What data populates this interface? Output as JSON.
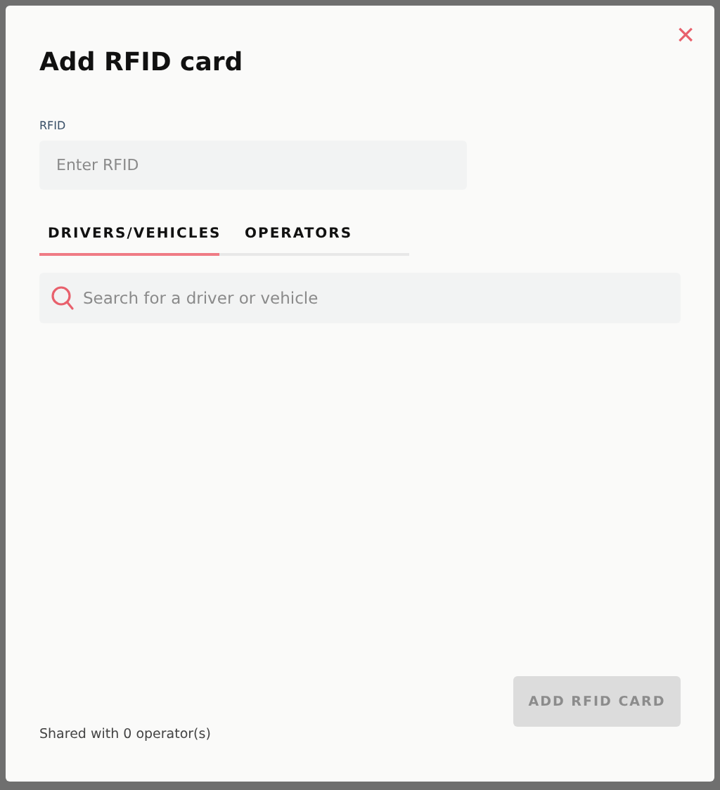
{
  "dialog": {
    "title": "Add RFID card",
    "close": "×"
  },
  "rfid": {
    "label": "RFID",
    "placeholder": "Enter RFID"
  },
  "tabs": [
    {
      "label": "DRIVERS/VEHICLES",
      "selected": true
    },
    {
      "label": "OPERATORS",
      "selected": false
    }
  ],
  "search": {
    "placeholder": "Search for a driver or vehicle"
  },
  "submit": {
    "label": "ADD RFID CARD",
    "disabled": true
  },
  "footer": "Shared with 0 operator(s)"
}
